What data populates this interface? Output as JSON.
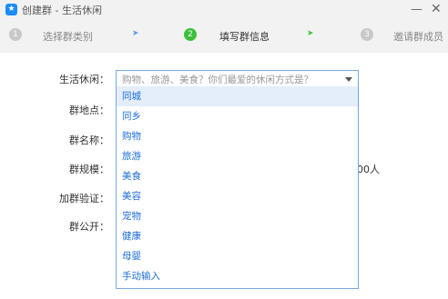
{
  "window": {
    "title": "创建群 - 生活休闲",
    "app_icon_glyph": "★",
    "minimize_glyph": "—",
    "close_glyph": "✕"
  },
  "steps": [
    {
      "number": "1",
      "label": "选择群类别",
      "state": "inactive"
    },
    {
      "number": "2",
      "label": "填写群信息",
      "state": "active"
    },
    {
      "number": "3",
      "label": "邀请群成员",
      "state": "inactive"
    }
  ],
  "step_arrow_glyph": "➤",
  "form": {
    "category_label": "生活休闲：",
    "category_placeholder": "购物、旅游、美食？你们最爱的休闲方式是？",
    "location_label": "群地点：",
    "name_label": "群名称：",
    "size_label": "群规模：",
    "size_value_suffix": "00人",
    "verify_label": "加群验证：",
    "public_label": "群公开："
  },
  "dropdown": {
    "selected_index": 0,
    "options": [
      "同城",
      "同乡",
      "购物",
      "旅游",
      "美食",
      "美容",
      "宠物",
      "健康",
      "母婴",
      "手动输入"
    ]
  },
  "colors": {
    "accent_blue": "#1e6fd9",
    "active_green": "#3cbf3c",
    "border_blue": "#7aa7e0",
    "selected_bg": "#e3eefa"
  }
}
